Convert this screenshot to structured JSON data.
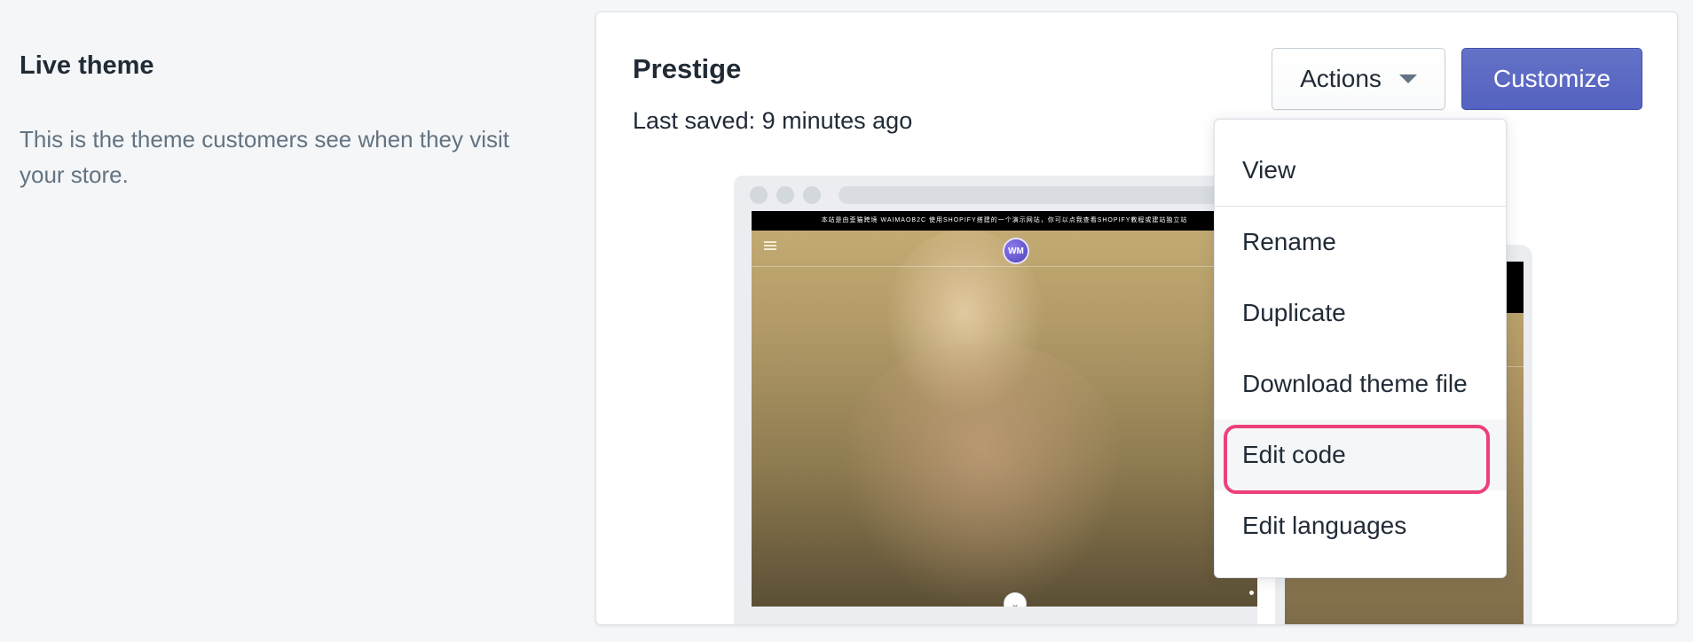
{
  "section": {
    "title": "Live theme",
    "description": "This is the theme customers see when they visit your store."
  },
  "theme": {
    "name": "Prestige",
    "last_saved_label": "Last saved:",
    "last_saved_value": "9 minutes ago"
  },
  "buttons": {
    "actions_label": "Actions",
    "customize_label": "Customize"
  },
  "actions_menu": {
    "items": [
      {
        "label": "View"
      },
      {
        "label": "Rename"
      },
      {
        "label": "Duplicate"
      },
      {
        "label": "Download theme file"
      },
      {
        "label": "Edit code"
      },
      {
        "label": "Edit languages"
      }
    ],
    "highlighted_item": "Edit code"
  },
  "preview": {
    "announcement": "本站是由歪猫跨境 WAIMAOB2C 使用SHOPIFY搭建的一个演示网站，你可以点我查看SHOPIFY教程或建站独立站",
    "logo_text": "WM"
  },
  "colors": {
    "primary": "#5c6ac4",
    "highlight": "#ec407a",
    "text": "#212b36",
    "subdued": "#637381",
    "background": "#f4f6f8"
  }
}
